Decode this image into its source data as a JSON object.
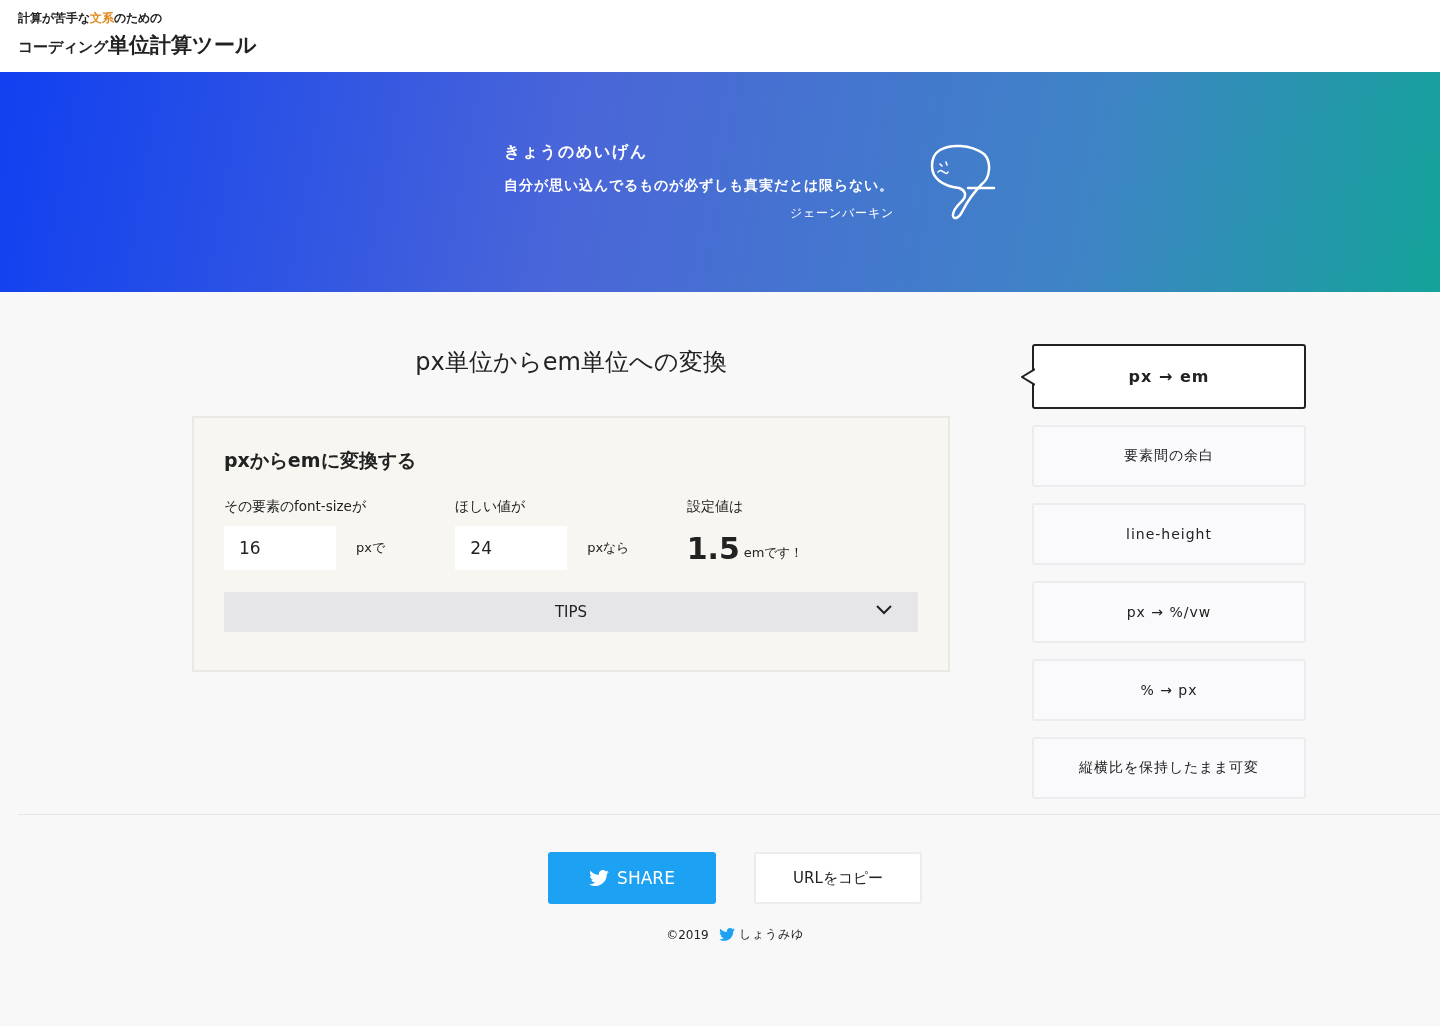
{
  "logo": {
    "tagline": [
      {
        "text": "計算が苦手な",
        "highlight": false
      },
      {
        "text": "文系",
        "highlight": true
      },
      {
        "text": "のための",
        "highlight": false
      }
    ],
    "title_prefix": "コーディング",
    "title_main": "単位計算ツール"
  },
  "quote": {
    "heading": "きょうのめいげん",
    "text": "自分が思い込んでるものが必ずしも真実だとは限らない。",
    "author": "ジェーンバーキン"
  },
  "converter": {
    "page_title": "px単位からem単位への変換",
    "card_title": "pxからemに変換する",
    "fields": [
      {
        "label": "その要素のfont-sizeが",
        "value": "16",
        "unit": "pxで"
      },
      {
        "label": "ほしい値が",
        "value": "24",
        "unit": "pxなら"
      }
    ],
    "result": {
      "label": "設定値は",
      "value": "1.5",
      "unit": "emです！"
    },
    "tips": {
      "label": "TIPS",
      "expanded": false
    }
  },
  "nav": [
    {
      "label": "px → em",
      "selected": true
    },
    {
      "label": "要素間の余白",
      "selected": false
    },
    {
      "label": "line-height",
      "selected": false
    },
    {
      "label": "px → %/vw",
      "selected": false
    },
    {
      "label": "% → px",
      "selected": false
    },
    {
      "label": "縦横比を保持したまま可変",
      "selected": false
    }
  ],
  "share_button": "SHARE",
  "copy_button": "URLをコピー",
  "footer": {
    "copyright": "©2019",
    "author": "しょうみゆ"
  }
}
